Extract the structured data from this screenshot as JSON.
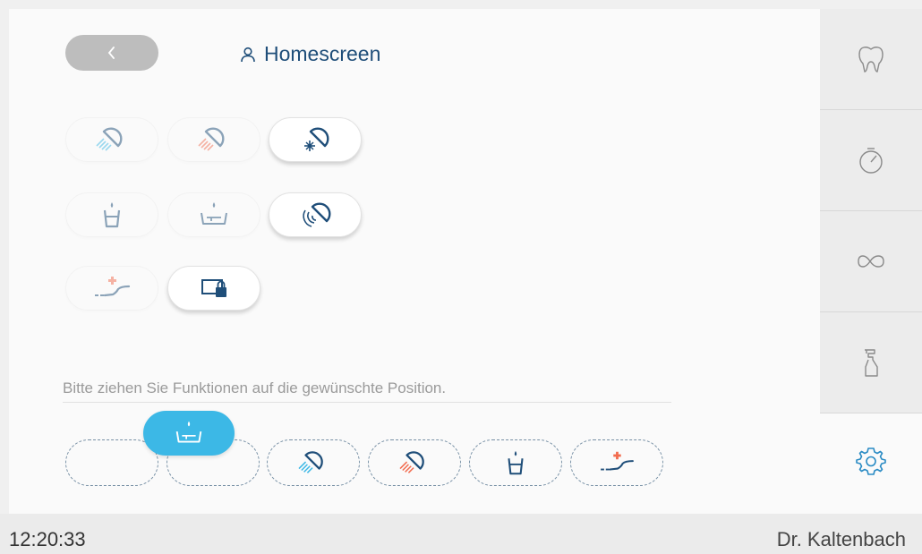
{
  "header": {
    "title": "Homescreen",
    "back_icon": "chevron-left-icon",
    "title_icon": "user-icon"
  },
  "function_grid": [
    {
      "name": "spray-blue-button",
      "icon": "spray-blue-icon",
      "active": false
    },
    {
      "name": "spray-red-button",
      "icon": "spray-red-icon",
      "active": false
    },
    {
      "name": "lamp-sparkle-button",
      "icon": "lamp-sparkle-icon",
      "active": true
    },
    {
      "name": "cup-fill-button",
      "icon": "cup-fill-icon",
      "active": false
    },
    {
      "name": "bowl-rinse-button",
      "icon": "bowl-rinse-icon",
      "active": false
    },
    {
      "name": "lamp-sound-button",
      "icon": "lamp-sound-icon",
      "active": true
    },
    {
      "name": "chair-position-button",
      "icon": "chair-position-icon",
      "active": false
    },
    {
      "name": "screen-lock-button",
      "icon": "screen-lock-icon",
      "active": true
    }
  ],
  "hint": {
    "text": "Bitte ziehen Sie Funktionen auf die gewünschte Position."
  },
  "slots": [
    {
      "name": "slot-1",
      "icon": ""
    },
    {
      "name": "slot-2",
      "icon": ""
    },
    {
      "name": "slot-3",
      "icon": "spray-blue-icon"
    },
    {
      "name": "slot-4",
      "icon": "spray-red-icon"
    },
    {
      "name": "slot-5",
      "icon": "cup-fill-icon"
    },
    {
      "name": "slot-6",
      "icon": "chair-position-icon"
    }
  ],
  "dragging_item": {
    "icon": "bowl-rinse-icon"
  },
  "sidebar": {
    "tabs": [
      {
        "name": "tooth-icon"
      },
      {
        "name": "timer-icon"
      },
      {
        "name": "infinity-icon"
      },
      {
        "name": "spray-bottle-icon"
      }
    ],
    "settings_icon": "settings-gear-icon"
  },
  "statusbar": {
    "time": "12:20:33",
    "user": "Dr. Kaltenbach"
  },
  "colors": {
    "primary": "#1f4e79",
    "accent_blue": "#3cb8e6",
    "accent_red": "#f26c4f",
    "settings": "#2a8bc4"
  }
}
